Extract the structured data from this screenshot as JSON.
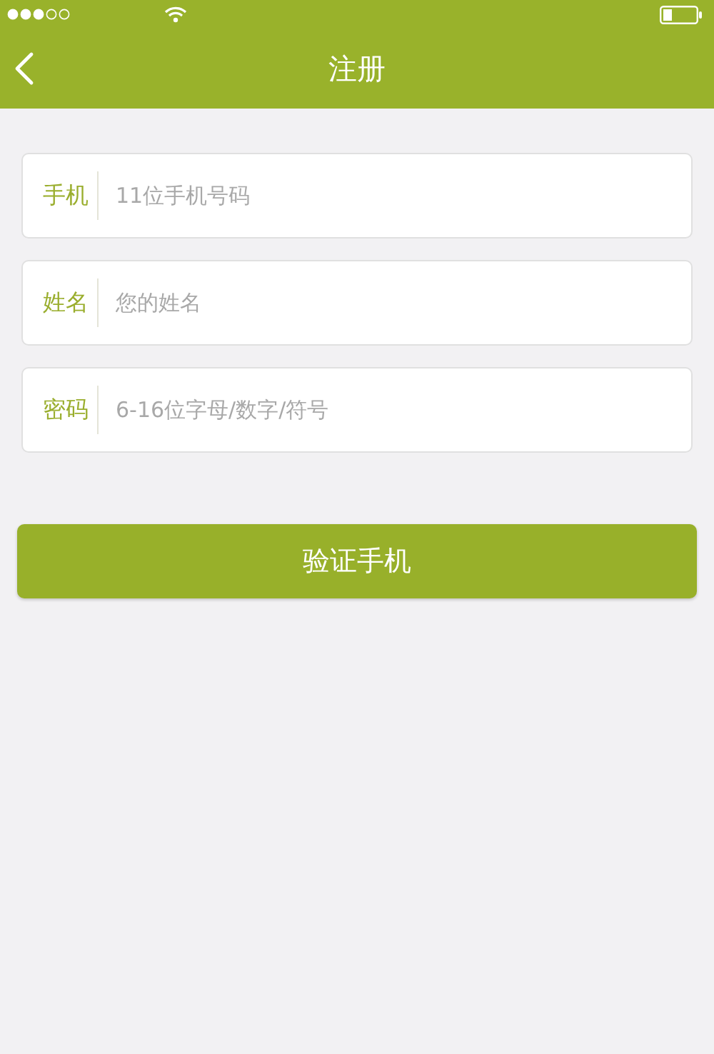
{
  "nav_bar": {
    "title": "注册"
  },
  "fields": [
    {
      "label": "手机",
      "placeholder": "11位手机号码"
    },
    {
      "label": "姓名",
      "placeholder": "您的姓名"
    },
    {
      "label": "密码",
      "placeholder": "6-16位字母/数字/符号"
    }
  ],
  "submit_button": {
    "label": "验证手机"
  }
}
